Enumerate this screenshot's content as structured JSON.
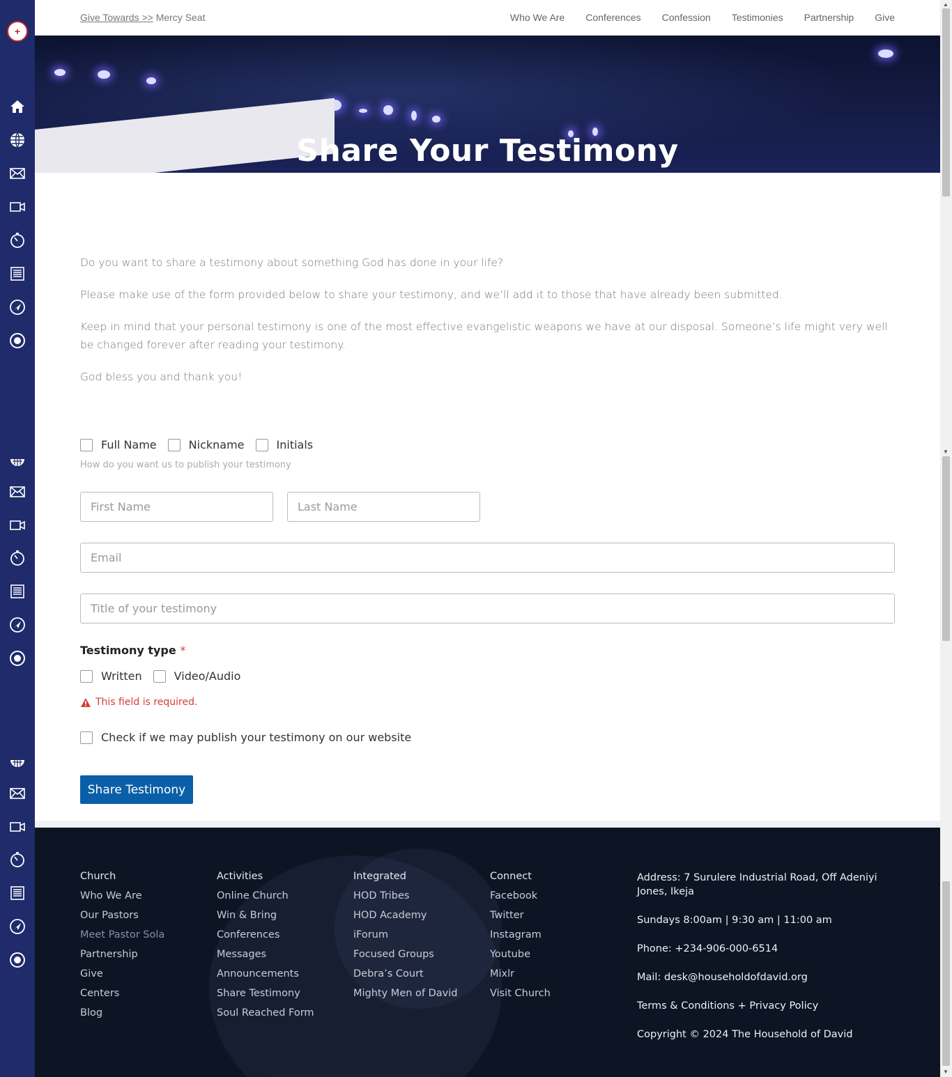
{
  "breadcrumb": {
    "link": "Give Towards >>",
    "current": "Mercy Seat"
  },
  "nav": [
    "Who We Are",
    "Conferences",
    "Confession",
    "Testimonies",
    "Partnership",
    "Give"
  ],
  "hero": {
    "title": "Share Your Testimony"
  },
  "intro": [
    "Do you want to share a testimony about something God has done in your life?",
    "Please make use of the form provided below to share your testimony, and we’ll add it to those that have already been submitted.",
    "Keep in mind that your personal testimony is one of the most effective evangelistic weapons we have at our disposal. Someone’s life might very well be changed forever after reading your testimony.",
    "God bless you and thank you!"
  ],
  "form": {
    "publish_options": [
      "Full Name",
      "Nickname",
      "Initials"
    ],
    "publish_help": "How do you want us to publish your testimony",
    "first_name_placeholder": "First Name",
    "last_name_placeholder": "Last Name",
    "email_placeholder": "Email",
    "title_placeholder": "Title of your testimony",
    "type_label": "Testimony type",
    "required_mark": "*",
    "type_options": [
      "Written",
      "Video/Audio"
    ],
    "error": "This field is required.",
    "consent": "Check if we may publish your testimony on our website",
    "submit": "Share Testimony"
  },
  "footer": {
    "church": {
      "heading": "Church",
      "items": [
        "Who We Are",
        "Our Pastors",
        "Meet Pastor Sola",
        "Partnership",
        "Give",
        "Centers",
        "Blog"
      ]
    },
    "activities": {
      "heading": "Activities",
      "items": [
        "Online Church",
        "Win & Bring",
        "Conferences",
        "Messages",
        "Announcements",
        "Share Testimony",
        "Soul Reached Form"
      ]
    },
    "integrated": {
      "heading": "Integrated",
      "items": [
        "HOD Tribes",
        "HOD Academy",
        "iForum",
        "Focused Groups",
        "Debra’s Court",
        "Mighty Men of David"
      ]
    },
    "connect": {
      "heading": "Connect",
      "items": [
        "Facebook",
        "Twitter",
        "Instagram",
        "Youtube",
        "Mixlr",
        "Visit Church"
      ]
    },
    "info": {
      "address": "Address:  7 Surulere Industrial Road, Off Adeniyi Jones, Ikeja",
      "sundays": "Sundays  8:00am | 9:30 am | 11:00 am",
      "phone": "Phone:   +234-906-000-6514",
      "mail": "Mail: desk@householdofdavid.org",
      "terms": "Terms & Conditions + Privacy Policy",
      "copyright": "Copyright © 2024 The Household of David"
    }
  },
  "sidebar_icons": [
    "home-icon",
    "globe-icon",
    "mail-icon",
    "video-icon",
    "timer-icon",
    "news-icon",
    "navigate-icon",
    "radio-icon"
  ],
  "colors": {
    "sidebar": "#1f2b6b",
    "button": "#0a5fa8",
    "error": "#d63c3c",
    "footer": "#0d1424"
  }
}
